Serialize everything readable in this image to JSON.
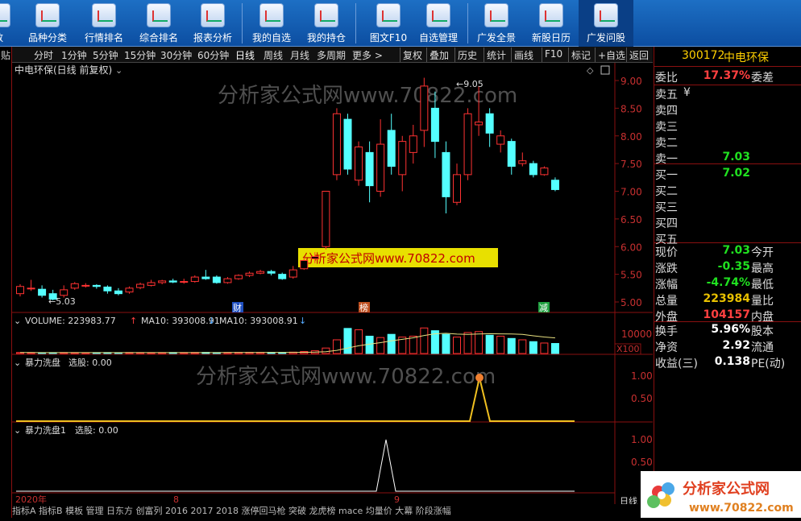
{
  "toolbar": {
    "items": [
      {
        "label": "数",
        "icon": "menu-icon"
      },
      {
        "label": "品种分类",
        "icon": "category-icon"
      },
      {
        "label": "行情排名",
        "icon": "ranking-icon"
      },
      {
        "label": "综合排名",
        "icon": "bar-rank-icon"
      },
      {
        "label": "报表分析",
        "icon": "report-icon"
      },
      {
        "label": "我的自选",
        "icon": "favorites-icon"
      },
      {
        "label": "我的持仓",
        "icon": "holdings-icon"
      },
      {
        "label": "图文F10",
        "icon": "f10-icon"
      },
      {
        "label": "自选管理",
        "icon": "manage-icon"
      },
      {
        "label": "广发全景",
        "icon": "panorama-icon"
      },
      {
        "label": "新股日历",
        "icon": "calendar-icon"
      },
      {
        "label": "广发问股",
        "icon": "ask-icon"
      }
    ]
  },
  "periodbar": {
    "left_items": [
      "分时",
      "1分钟",
      "5分钟",
      "15分钟",
      "30分钟",
      "60分钟",
      "日线",
      "周线",
      "月线",
      "多周期",
      "更多 >"
    ],
    "selected": "日线",
    "right_items": [
      "复权",
      "叠加",
      "历史",
      "统计",
      "画线",
      "F10",
      "标记",
      "+自选",
      "返回"
    ]
  },
  "chart": {
    "title": "中电环保(日线 前复权)",
    "watermark": "分析家公式网www.70822.com",
    "watermark_banner": "分析家公式网www.70822.com",
    "price_high_label": "9.05",
    "price_low_label": "5.03",
    "event_tags": [
      "财",
      "榜",
      "减"
    ],
    "volume_label": "VOLUME: 223983.77",
    "ma_label_1": "MA10: 393008.91",
    "ma_label_2": "MA10: 393008.91",
    "volume_unit": "X100",
    "volume_tick": "10000",
    "ind1_label": "暴力洗盘",
    "ind1_sel": "选股: 0.00",
    "ind2_label": "暴力洗盘1",
    "ind2_sel": "选股: 0.00",
    "date_labels": [
      "2020年",
      "8",
      "9"
    ],
    "bottom_right": "日线"
  },
  "chart_data": {
    "type": "candlestick",
    "y_axis_ticks": [
      "9.00",
      "8.50",
      "8.00",
      "7.50",
      "7.00",
      "6.50",
      "6.00",
      "5.50",
      "5.00"
    ],
    "ind_ticks": [
      "1.00",
      "0.50"
    ],
    "candles": [
      {
        "o": 5.15,
        "c": 5.28,
        "h": 5.32,
        "l": 5.1
      },
      {
        "o": 5.25,
        "c": 5.25,
        "h": 5.4,
        "l": 5.2
      },
      {
        "o": 5.23,
        "c": 5.12,
        "h": 5.3,
        "l": 5.08
      },
      {
        "o": 5.15,
        "c": 5.05,
        "h": 5.22,
        "l": 5.03
      },
      {
        "o": 5.12,
        "c": 5.22,
        "h": 5.3,
        "l": 5.08
      },
      {
        "o": 5.25,
        "c": 5.33,
        "h": 5.36,
        "l": 5.22
      },
      {
        "o": 5.3,
        "c": 5.3,
        "h": 5.34,
        "l": 5.26
      },
      {
        "o": 5.3,
        "c": 5.28,
        "h": 5.32,
        "l": 5.24
      },
      {
        "o": 5.27,
        "c": 5.2,
        "h": 5.3,
        "l": 5.15
      },
      {
        "o": 5.2,
        "c": 5.15,
        "h": 5.25,
        "l": 5.12
      },
      {
        "o": 5.18,
        "c": 5.25,
        "h": 5.28,
        "l": 5.15
      },
      {
        "o": 5.26,
        "c": 5.32,
        "h": 5.35,
        "l": 5.23
      },
      {
        "o": 5.3,
        "c": 5.35,
        "h": 5.4,
        "l": 5.28
      },
      {
        "o": 5.35,
        "c": 5.38,
        "h": 5.4,
        "l": 5.32
      },
      {
        "o": 5.38,
        "c": 5.36,
        "h": 5.42,
        "l": 5.34
      },
      {
        "o": 5.36,
        "c": 5.37,
        "h": 5.42,
        "l": 5.33
      },
      {
        "o": 5.37,
        "c": 5.45,
        "h": 5.48,
        "l": 5.35
      },
      {
        "o": 5.45,
        "c": 5.42,
        "h": 5.58,
        "l": 5.4
      },
      {
        "o": 5.45,
        "c": 5.35,
        "h": 5.48,
        "l": 5.33
      },
      {
        "o": 5.35,
        "c": 5.42,
        "h": 5.45,
        "l": 5.33
      },
      {
        "o": 5.42,
        "c": 5.48,
        "h": 5.5,
        "l": 5.4
      },
      {
        "o": 5.48,
        "c": 5.52,
        "h": 5.55,
        "l": 5.45
      },
      {
        "o": 5.52,
        "c": 5.55,
        "h": 5.58,
        "l": 5.5
      },
      {
        "o": 5.55,
        "c": 5.52,
        "h": 5.58,
        "l": 5.48
      },
      {
        "o": 5.5,
        "c": 5.42,
        "h": 5.53,
        "l": 5.4
      },
      {
        "o": 5.45,
        "c": 5.58,
        "h": 5.65,
        "l": 5.42
      },
      {
        "o": 5.6,
        "c": 5.75,
        "h": 5.8,
        "l": 5.58
      },
      {
        "o": 5.78,
        "c": 5.82,
        "h": 5.9,
        "l": 5.7
      },
      {
        "o": 6.0,
        "c": 7.0,
        "h": 7.0,
        "l": 5.95
      },
      {
        "o": 7.3,
        "c": 8.4,
        "h": 8.5,
        "l": 7.2
      },
      {
        "o": 8.3,
        "c": 7.4,
        "h": 8.4,
        "l": 7.3
      },
      {
        "o": 7.2,
        "c": 7.8,
        "h": 7.9,
        "l": 7.1
      },
      {
        "o": 7.7,
        "c": 7.1,
        "h": 7.9,
        "l": 6.8
      },
      {
        "o": 7.0,
        "c": 7.85,
        "h": 8.3,
        "l": 6.9
      },
      {
        "o": 8.1,
        "c": 7.45,
        "h": 8.4,
        "l": 7.3
      },
      {
        "o": 7.3,
        "c": 7.9,
        "h": 8.0,
        "l": 7.0
      },
      {
        "o": 7.7,
        "c": 8.0,
        "h": 8.2,
        "l": 7.5
      },
      {
        "o": 8.1,
        "c": 8.9,
        "h": 9.05,
        "l": 7.8
      },
      {
        "o": 8.5,
        "c": 7.9,
        "h": 8.8,
        "l": 7.6
      },
      {
        "o": 7.7,
        "c": 6.9,
        "h": 7.9,
        "l": 6.6
      },
      {
        "o": 6.8,
        "c": 7.3,
        "h": 7.5,
        "l": 6.75
      },
      {
        "o": 7.3,
        "c": 8.4,
        "h": 8.5,
        "l": 7.2
      },
      {
        "o": 8.2,
        "c": 8.25,
        "h": 8.9,
        "l": 8.0
      },
      {
        "o": 8.4,
        "c": 8.05,
        "h": 8.5,
        "l": 7.8
      },
      {
        "o": 7.85,
        "c": 8.0,
        "h": 8.1,
        "l": 7.7
      },
      {
        "o": 7.9,
        "c": 7.45,
        "h": 7.95,
        "l": 7.3
      },
      {
        "o": 7.5,
        "c": 7.55,
        "h": 7.7,
        "l": 7.45
      },
      {
        "o": 7.5,
        "c": 7.3,
        "h": 7.55,
        "l": 7.25
      },
      {
        "o": 7.3,
        "c": 7.42,
        "h": 7.45,
        "l": 7.28
      },
      {
        "o": 7.2,
        "c": 7.03,
        "h": 7.25,
        "l": 7.0
      }
    ],
    "volumes": [
      22,
      20,
      18,
      19,
      21,
      20,
      18,
      19,
      20,
      18,
      21,
      20,
      19,
      20,
      22,
      21,
      23,
      25,
      20,
      22,
      24,
      26,
      25,
      24,
      22,
      30,
      45,
      60,
      120,
      300,
      550,
      520,
      380,
      350,
      420,
      360,
      380,
      560,
      500,
      420,
      360,
      460,
      480,
      400,
      380,
      330,
      300,
      260,
      230,
      220
    ],
    "vol_max": 600,
    "ind1_values": "zero except a single spike to 1.0 near x≈593",
    "ind2_values": "zero except a single spike to 1.0 near x≈478"
  },
  "rpanel": {
    "code": "300172",
    "name": "中电环保",
    "rows": [
      {
        "l": "委比",
        "v": "17.37%",
        "r": "委差",
        "vc": "#ff4040"
      },
      {
        "l": "卖五",
        "v": "",
        "r": "",
        "extra": "¥"
      },
      {
        "l": "卖四",
        "v": "",
        "r": ""
      },
      {
        "l": "卖三",
        "v": "",
        "r": ""
      },
      {
        "l": "卖二",
        "v": "",
        "r": ""
      },
      {
        "l": "卖一",
        "v": "7.03",
        "r": "",
        "vc": "#20e020"
      },
      {
        "l": "买一",
        "v": "7.02",
        "r": "",
        "vc": "#20e020"
      },
      {
        "l": "买二",
        "v": "",
        "r": ""
      },
      {
        "l": "买三",
        "v": "",
        "r": ""
      },
      {
        "l": "买四",
        "v": "",
        "r": ""
      },
      {
        "l": "买五",
        "v": "",
        "r": ""
      },
      {
        "l": "现价",
        "v": "7.03",
        "r": "今开",
        "vc": "#20e020"
      },
      {
        "l": "涨跌",
        "v": "-0.35",
        "r": "最高",
        "vc": "#20e020"
      },
      {
        "l": "涨幅",
        "v": "-4.74%",
        "r": "最低",
        "vc": "#20e020"
      },
      {
        "l": "总量",
        "v": "223984",
        "r": "量比",
        "vc": "#e8c000"
      },
      {
        "l": "外盘",
        "v": "104157",
        "r": "内盘",
        "vc": "#ff4040"
      },
      {
        "l": "换手",
        "v": "5.96%",
        "r": "股本",
        "vc": "#ffffff"
      },
      {
        "l": "净资",
        "v": "2.92",
        "r": "流通",
        "vc": "#ffffff"
      },
      {
        "l": "收益(三)",
        "v": "0.138",
        "r": "PE(动)",
        "vc": "#ffffff"
      }
    ]
  },
  "bottombar": {
    "text": "指标A 指标B 模板 管理 日东方 创富列 2016 2017 2018 涨停回马枪 突破 龙虎榜 mace 均量价 大幕 阶段涨幅"
  },
  "logo": {
    "text": "分析家公式网",
    "url_text": "www.70822.com"
  },
  "colors": {
    "up": "#ff3232",
    "down": "#54ffff",
    "axis": "#8a1010",
    "toolbar": "#1565c0"
  }
}
